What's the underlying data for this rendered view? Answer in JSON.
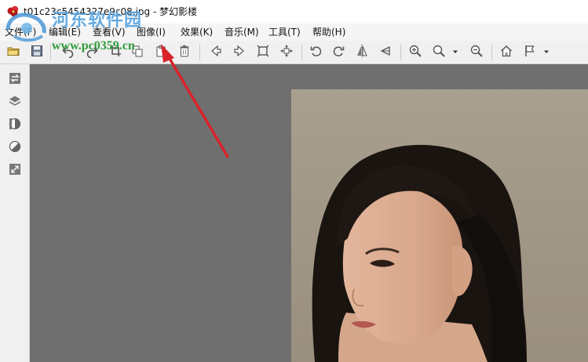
{
  "window": {
    "title": "t01c23c5454327e9c08.jpg - 梦幻影楼"
  },
  "menubar": {
    "items": [
      {
        "label": "文件(F)"
      },
      {
        "label": "编辑(E)"
      },
      {
        "label": "查看(V)"
      },
      {
        "label": "图像(I)"
      },
      {
        "label": "效果(K)"
      },
      {
        "label": "音乐(M)"
      },
      {
        "label": "工具(T)"
      },
      {
        "label": "帮助(H)"
      }
    ]
  },
  "toolbar": {
    "buttons": [
      {
        "icon": "open-folder-icon"
      },
      {
        "icon": "save-icon"
      },
      {
        "icon": "undo-icon"
      },
      {
        "icon": "redo-icon"
      },
      {
        "icon": "crop-icon"
      },
      {
        "icon": "copy-icon"
      },
      {
        "icon": "paste-icon"
      },
      {
        "icon": "delete-icon"
      },
      {
        "icon": "previous-icon"
      },
      {
        "icon": "next-icon"
      },
      {
        "icon": "fit-window-icon"
      },
      {
        "icon": "actual-size-icon"
      },
      {
        "icon": "rotate-left-icon"
      },
      {
        "icon": "rotate-right-icon"
      },
      {
        "icon": "flip-horizontal-icon"
      },
      {
        "icon": "flip-vertical-icon"
      },
      {
        "icon": "zoom-in-icon"
      },
      {
        "icon": "zoom-icon"
      },
      {
        "icon": "zoom-out-icon"
      },
      {
        "icon": "home-icon"
      },
      {
        "icon": "flag-icon"
      }
    ]
  },
  "sidebar": {
    "buttons": [
      {
        "icon": "swap-icon"
      },
      {
        "icon": "layers-icon"
      },
      {
        "icon": "contrast-icon"
      },
      {
        "icon": "brightness-icon"
      },
      {
        "icon": "resize-icon"
      }
    ]
  },
  "watermark": {
    "title": "河东软件园",
    "url": "www.pc0359.cn"
  },
  "colors": {
    "canvas_background": "#6f6f6f",
    "arrow": "#d9232a",
    "watermark_blue": "#5aa4df",
    "watermark_green": "#2f9a3b"
  }
}
